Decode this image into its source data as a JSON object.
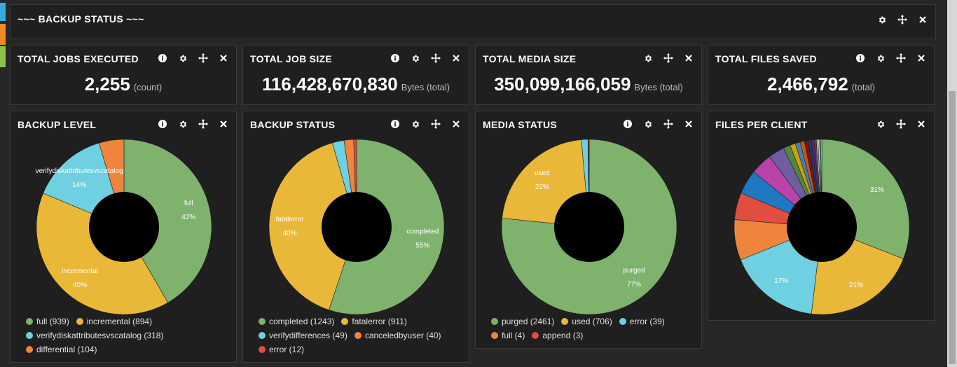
{
  "header": {
    "title": "~~~ BACKUP STATUS ~~~"
  },
  "metrics": [
    {
      "title": "TOTAL JOBS EXECUTED",
      "value": "2,255",
      "unit": "(count)"
    },
    {
      "title": "TOTAL JOB SIZE",
      "value": "116,428,670,830",
      "unit": "Bytes (total)"
    },
    {
      "title": "TOTAL MEDIA SIZE",
      "value": "350,099,166,059",
      "unit": "Bytes (total)"
    },
    {
      "title": "TOTAL FILES SAVED",
      "value": "2,466,792",
      "unit": "(total)"
    }
  ],
  "charts": [
    {
      "title": "BACKUP LEVEL",
      "chart_data": {
        "type": "pie",
        "donut": true,
        "slices": [
          {
            "label": "full",
            "value": 939,
            "pct": "42%",
            "color": "#7eb26d",
            "legend": "full (939)"
          },
          {
            "label": "incremental",
            "value": 894,
            "pct": "40%",
            "color": "#eab839",
            "legend": "incremental (894)"
          },
          {
            "label": "verifydiskattributesvscatalog",
            "value": 318,
            "pct": "14%",
            "color": "#6ed0e0",
            "legend": "verifydiskattributesvscatalog (318)"
          },
          {
            "label": "differential",
            "value": 104,
            "pct": "",
            "color": "#ef843c",
            "legend": "differential (104)"
          }
        ]
      }
    },
    {
      "title": "BACKUP STATUS",
      "chart_data": {
        "type": "pie",
        "donut": true,
        "slices": [
          {
            "label": "completed",
            "value": 1243,
            "pct": "55%",
            "color": "#7eb26d",
            "legend": "completed (1243)"
          },
          {
            "label": "fatalerror",
            "value": 911,
            "pct": "40%",
            "color": "#eab839",
            "legend": "fatalerror (911)"
          },
          {
            "label": "verifydifferences",
            "value": 49,
            "pct": "",
            "color": "#6ed0e0",
            "legend": "verifydifferences (49)"
          },
          {
            "label": "canceledbyuser",
            "value": 40,
            "pct": "",
            "color": "#ef843c",
            "legend": "canceledbyuser (40)"
          },
          {
            "label": "error",
            "value": 12,
            "pct": "",
            "color": "#e24d42",
            "legend": "error (12)"
          }
        ]
      }
    },
    {
      "title": "MEDIA STATUS",
      "chart_data": {
        "type": "pie",
        "donut": true,
        "slices": [
          {
            "label": "purged",
            "value": 2461,
            "pct": "77%",
            "color": "#7eb26d",
            "legend": "purged (2461)"
          },
          {
            "label": "used",
            "value": 706,
            "pct": "22%",
            "color": "#eab839",
            "legend": "used (706)"
          },
          {
            "label": "error",
            "value": 39,
            "pct": "",
            "color": "#6ed0e0",
            "legend": "error (39)"
          },
          {
            "label": "full",
            "value": 4,
            "pct": "",
            "color": "#ef843c",
            "legend": "full (4)"
          },
          {
            "label": "append",
            "value": 3,
            "pct": "",
            "color": "#e24d42",
            "legend": "append (3)"
          }
        ]
      }
    },
    {
      "title": "FILES PER CLIENT",
      "chart_data": {
        "type": "pie",
        "donut": true,
        "slices": [
          {
            "label": "",
            "value": 31,
            "pct": "31%",
            "color": "#7eb26d"
          },
          {
            "label": "",
            "value": 21,
            "pct": "21%",
            "color": "#eab839"
          },
          {
            "label": "",
            "value": 17,
            "pct": "17%",
            "color": "#6ed0e0"
          },
          {
            "label": "",
            "value": 7.5,
            "pct": "",
            "color": "#ef843c"
          },
          {
            "label": "",
            "value": 5,
            "pct": "",
            "color": "#e24d42"
          },
          {
            "label": "",
            "value": 4.5,
            "pct": "",
            "color": "#1f78c1"
          },
          {
            "label": "",
            "value": 4,
            "pct": "",
            "color": "#ba43a9"
          },
          {
            "label": "",
            "value": 3,
            "pct": "",
            "color": "#705da0"
          },
          {
            "label": "",
            "value": 1.3,
            "pct": "",
            "color": "#508642"
          },
          {
            "label": "",
            "value": 1,
            "pct": "",
            "color": "#cca300"
          },
          {
            "label": "",
            "value": 0.9,
            "pct": "",
            "color": "#447ebc"
          },
          {
            "label": "",
            "value": 0.8,
            "pct": "",
            "color": "#c15c17"
          },
          {
            "label": "",
            "value": 0.7,
            "pct": "",
            "color": "#890f02"
          },
          {
            "label": "",
            "value": 0.6,
            "pct": "",
            "color": "#0a437c"
          },
          {
            "label": "",
            "value": 0.5,
            "pct": "",
            "color": "#6d1f62"
          },
          {
            "label": "",
            "value": 0.4,
            "pct": "",
            "color": "#584477"
          },
          {
            "label": "",
            "value": 0.3,
            "pct": "",
            "color": "#b7dbab"
          },
          {
            "label": "",
            "value": 0.3,
            "pct": "",
            "color": "#f4d598"
          },
          {
            "label": "",
            "value": 0.2,
            "pct": "",
            "color": "#70dbed"
          },
          {
            "label": "",
            "value": 0.2,
            "pct": "",
            "color": "#f9ba8f"
          }
        ]
      }
    }
  ],
  "icons": {
    "info": "info-icon",
    "settings": "gear-icon",
    "move": "move-icon",
    "close": "close-icon"
  }
}
